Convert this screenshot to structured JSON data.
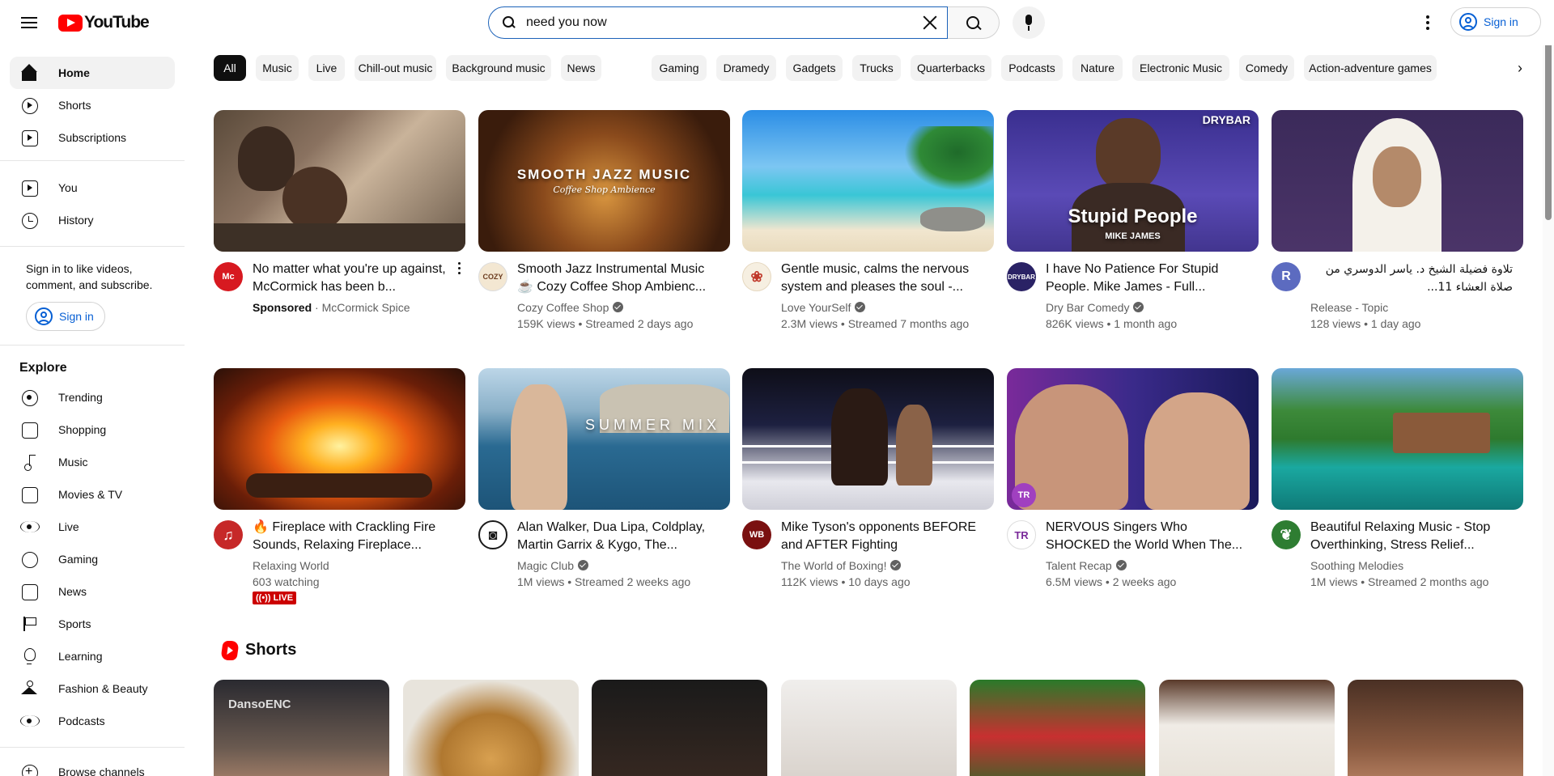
{
  "app": {
    "logo_text": "YouTube"
  },
  "search": {
    "value": "need you now",
    "placeholder": "Search"
  },
  "header": {
    "signin_label": "Sign in"
  },
  "sidebar": {
    "primary": [
      {
        "label": "Home",
        "icon": "home-icon"
      },
      {
        "label": "Shorts",
        "icon": "shorts-icon"
      },
      {
        "label": "Subscriptions",
        "icon": "subscriptions-icon"
      }
    ],
    "you": [
      {
        "label": "You",
        "icon": "you-icon"
      },
      {
        "label": "History",
        "icon": "history-icon"
      }
    ],
    "signin_prompt": "Sign in to like videos, comment, and subscribe.",
    "signin_label": "Sign in",
    "explore_title": "Explore",
    "explore": [
      {
        "label": "Trending",
        "icon": "trending-icon"
      },
      {
        "label": "Shopping",
        "icon": "shopping-icon"
      },
      {
        "label": "Music",
        "icon": "music-icon"
      },
      {
        "label": "Movies & TV",
        "icon": "movies-icon"
      },
      {
        "label": "Live",
        "icon": "live-icon"
      },
      {
        "label": "Gaming",
        "icon": "gaming-icon"
      },
      {
        "label": "News",
        "icon": "news-icon"
      },
      {
        "label": "Sports",
        "icon": "sports-icon"
      },
      {
        "label": "Learning",
        "icon": "learning-icon"
      },
      {
        "label": "Fashion & Beauty",
        "icon": "fashion-icon"
      },
      {
        "label": "Podcasts",
        "icon": "podcasts-icon"
      }
    ],
    "browse_channels": "Browse channels"
  },
  "chips": [
    "All",
    "Music",
    "Live",
    "Chill-out music",
    "Background music",
    "News",
    "Gaming",
    "Dramedy",
    "Gadgets",
    "Trucks",
    "Quarterbacks",
    "Podcasts",
    "Nature",
    "Electronic Music",
    "Comedy",
    "Action-adventure games"
  ],
  "videos": [
    {
      "title": "No matter what you're up against, McCormick has been b...",
      "channel": "McCormick Spice",
      "sponsored": "Sponsored",
      "meta": "",
      "thumb_text": "",
      "avatar_text": "Mc",
      "avatar_color": "#d71920"
    },
    {
      "title": "Smooth Jazz Instrumental Music ☕ Cozy Coffee Shop Ambienc...",
      "channel": "Cozy Coffee Shop",
      "meta": "159K views • Streamed 2 days ago",
      "thumb_text": "SMOOTH JAZZ MUSIC",
      "thumb_sub": "Coffee Shop Ambience",
      "avatar_text": "COZY",
      "avatar_color": "#6b3b1e"
    },
    {
      "title": "Gentle music, calms the nervous system and pleases the soul -...",
      "channel": "Love YourSelf",
      "meta": "2.3M views • Streamed 7 months ago",
      "thumb_text": "",
      "avatar_text": "❀",
      "avatar_color": "#f6efe1"
    },
    {
      "title": "I have No Patience For Stupid People. Mike James - Full...",
      "channel": "Dry Bar Comedy",
      "meta": "826K views • 1 month ago",
      "thumb_text": "Stupid People",
      "thumb_sub": "MIKE JAMES",
      "thumb_brand": "DRYBAR",
      "avatar_text": "DRYBAR",
      "avatar_color": "#2a2265"
    },
    {
      "title": "تلاوة فضيلة الشيخ د. ياسر الدوسري من صلاة العشاء 11...",
      "channel": "Release - Topic",
      "meta": "128 views • 1 day ago",
      "thumb_text": "",
      "avatar_text": "R",
      "avatar_color": "#5c6bc0"
    },
    {
      "title": "🔥 Fireplace with Crackling Fire Sounds, Relaxing Fireplace...",
      "channel": "Relaxing World",
      "meta": "603 watching",
      "live": "LIVE",
      "thumb_text": "",
      "avatar_text": "♫",
      "avatar_color": "#c62828"
    },
    {
      "title": "Alan Walker, Dua Lipa, Coldplay, Martin Garrix & Kygo, The...",
      "channel": "Magic Club",
      "meta": "1M views • Streamed 2 weeks ago",
      "thumb_text": "SUMMER MIX",
      "avatar_text": "◙",
      "avatar_color": "#1a1a1a"
    },
    {
      "title": "Mike Tyson's opponents BEFORE and AFTER Fighting",
      "channel": "The World of Boxing!",
      "meta": "112K views • 10 days ago",
      "thumb_text": "",
      "avatar_text": "WB",
      "avatar_color": "#7a1010"
    },
    {
      "title": "NERVOUS Singers Who SHOCKED the World When The...",
      "channel": "Talent Recap",
      "meta": "6.5M views • 2 weeks ago",
      "thumb_text": "",
      "thumb_brand": "TR",
      "avatar_text": "TR",
      "avatar_color": "#ffffff"
    },
    {
      "title": "Beautiful Relaxing Music - Stop Overthinking, Stress Relief...",
      "channel": "Soothing Melodies",
      "meta": "1M views • Streamed 2 months ago",
      "thumb_text": "",
      "avatar_text": "❦",
      "avatar_color": "#2e7d32"
    }
  ],
  "shorts": {
    "title": "Shorts",
    "items": [
      {
        "overlay": "DansoENC"
      },
      {
        "overlay": ""
      },
      {
        "overlay": ""
      },
      {
        "overlay": ""
      },
      {
        "overlay": ""
      },
      {
        "overlay": ""
      },
      {
        "overlay": ""
      }
    ]
  },
  "colors": {
    "brand_red": "#ff0000",
    "link_blue": "#065fd4",
    "chip_bg": "#f2f2f2",
    "text_secondary": "#606060"
  }
}
